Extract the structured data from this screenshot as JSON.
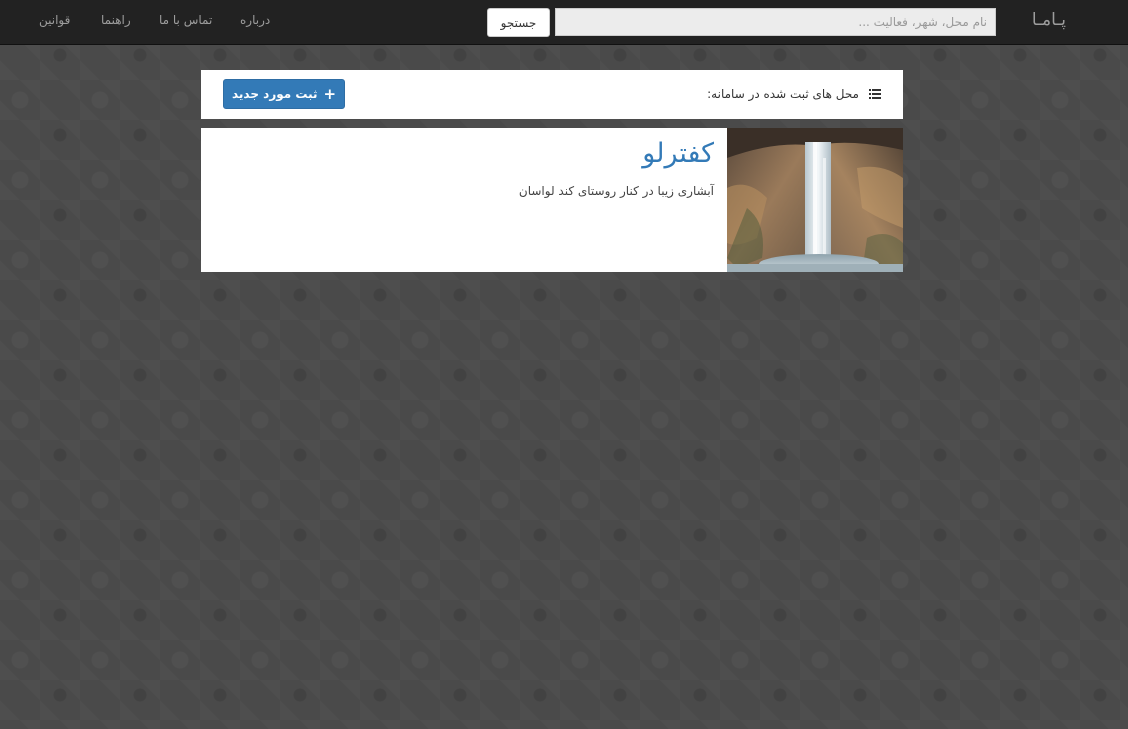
{
  "navbar": {
    "brand": "پـامـا",
    "search": {
      "placeholder": "نام محل، شهر، فعالیت ...",
      "value": "",
      "button_label": "جستجو"
    },
    "links": {
      "about": "درباره",
      "contact": "تماس با ما",
      "guide": "راهنما",
      "rules": "قوانین"
    }
  },
  "header": {
    "title": "محل های ثبت شده در سامانه:",
    "icon": "list-icon",
    "add_button_label": "ثبت مورد جدید",
    "add_button_icon": "plus-icon"
  },
  "places": [
    {
      "title": "کفترلو",
      "description": "آبشاری زیبا در کنار روستای کند لواسان",
      "image": "waterfall-photo"
    }
  ],
  "colors": {
    "navbar_bg": "#222222",
    "primary": "#337ab7",
    "page_bg": "#4a4a4a"
  }
}
